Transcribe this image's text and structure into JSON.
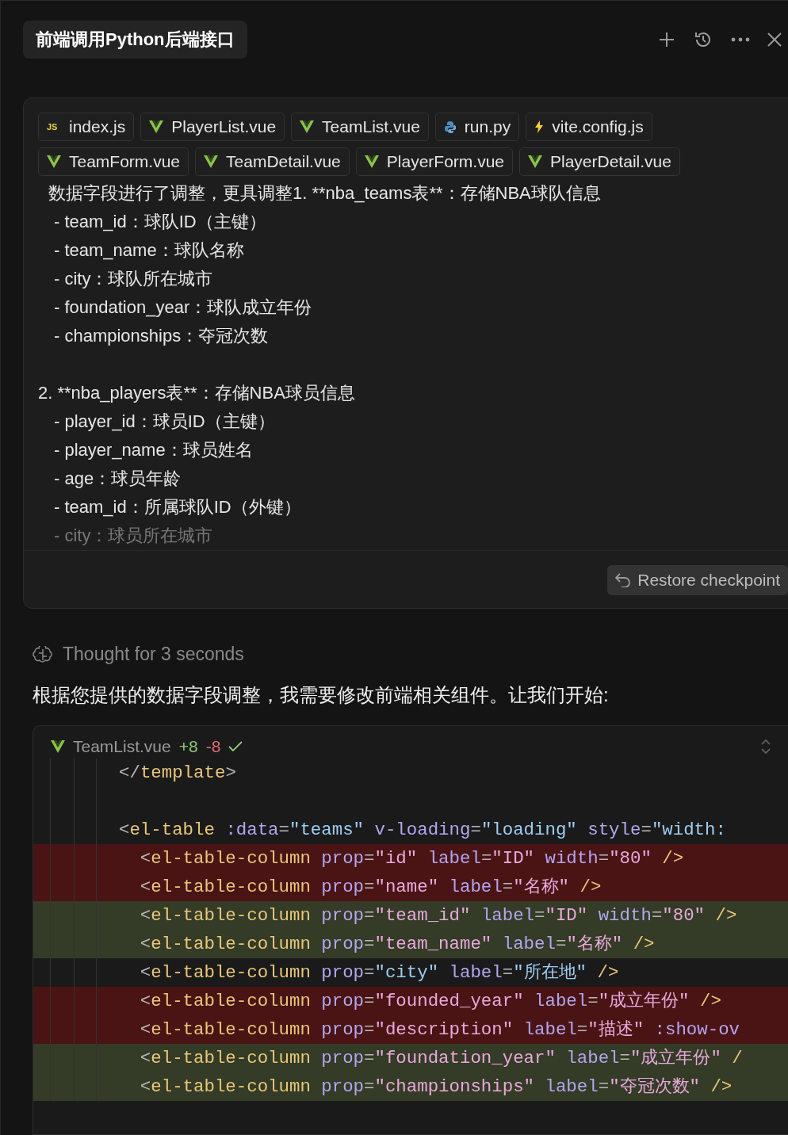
{
  "header": {
    "title": "前端调用Python后端接口"
  },
  "message": {
    "files": [
      {
        "name": "index.js",
        "kind": "js",
        "badge": "JS"
      },
      {
        "name": "PlayerList.vue",
        "kind": "vue"
      },
      {
        "name": "TeamList.vue",
        "kind": "vue"
      },
      {
        "name": "run.py",
        "kind": "py"
      },
      {
        "name": "vite.config.js",
        "kind": "vite"
      },
      {
        "name": "TeamForm.vue",
        "kind": "vue"
      },
      {
        "name": "TeamDetail.vue",
        "kind": "vue"
      },
      {
        "name": "PlayerForm.vue",
        "kind": "vue"
      },
      {
        "name": "PlayerDetail.vue",
        "kind": "vue"
      }
    ],
    "lines": [
      {
        "kind": "lead",
        "text": "数据字段进行了调整，更具调整1. **nba_teams表**：存储NBA球队信息",
        "faded": false
      },
      {
        "kind": "bullet",
        "text": "- team_id：球队ID（主键）",
        "faded": false
      },
      {
        "kind": "bullet",
        "text": "- team_name：球队名称",
        "faded": false
      },
      {
        "kind": "bullet",
        "text": "- city：球队所在城市",
        "faded": false
      },
      {
        "kind": "bullet",
        "text": "- foundation_year：球队成立年份",
        "faded": false
      },
      {
        "kind": "bullet",
        "text": "- championships：夺冠次数",
        "faded": false
      },
      {
        "kind": "numbered",
        "text": "2. **nba_players表**：存储NBA球员信息",
        "faded": false
      },
      {
        "kind": "bullet",
        "text": "- player_id：球员ID（主键）",
        "faded": false
      },
      {
        "kind": "bullet",
        "text": "- player_name：球员姓名",
        "faded": false
      },
      {
        "kind": "bullet",
        "text": "- age：球员年龄",
        "faded": false
      },
      {
        "kind": "bullet",
        "text": "- team_id：所属球队ID（外键）",
        "faded": false
      },
      {
        "kind": "bullet",
        "text": "- city：球员所在城市",
        "faded": true
      }
    ],
    "restore_button": "Restore checkpoint"
  },
  "thought": "Thought for 3 seconds",
  "reply": "根据您提供的数据字段调整，我需要修改前端相关组件。让我们开始:",
  "code_block": {
    "file": "TeamList.vue",
    "added": "+8",
    "removed": "-8",
    "applied": true,
    "lines": [
      {
        "kind": "plain",
        "tokens": [
          {
            "kind": "punct",
            "text": "</"
          },
          {
            "kind": "tag",
            "text": "template"
          },
          {
            "kind": "punct",
            "text": ">"
          }
        ]
      },
      {
        "kind": "plain"
      },
      {
        "kind": "plain",
        "tokens": [
          {
            "kind": "punct",
            "text": "<"
          },
          {
            "kind": "tag",
            "text": "el-table "
          },
          {
            "kind": "attr",
            "text": ":data"
          },
          {
            "kind": "punct",
            "text": "="
          },
          {
            "kind": "str",
            "text": "\"teams\" "
          },
          {
            "kind": "attr",
            "text": "v-loading"
          },
          {
            "kind": "punct",
            "text": "="
          },
          {
            "kind": "str",
            "text": "\"loading\" "
          },
          {
            "kind": "attr",
            "text": "style"
          },
          {
            "kind": "punct",
            "text": "="
          },
          {
            "kind": "str",
            "text": "\"width:"
          }
        ]
      },
      {
        "kind": "removed",
        "tokens": [
          {
            "kind": "punct",
            "text": "  <"
          },
          {
            "kind": "tag",
            "text": "el-table-column "
          },
          {
            "kind": "attr",
            "text": "prop"
          },
          {
            "kind": "punct",
            "text": "="
          },
          {
            "kind": "str",
            "text": "\"id\" "
          },
          {
            "kind": "attr",
            "text": "label"
          },
          {
            "kind": "punct",
            "text": "="
          },
          {
            "kind": "str",
            "text": "\"ID\" "
          },
          {
            "kind": "attr",
            "text": "width"
          },
          {
            "kind": "punct",
            "text": "="
          },
          {
            "kind": "str",
            "text": "\"80\" "
          },
          {
            "kind": "tag",
            "text": "/>"
          }
        ]
      },
      {
        "kind": "removed",
        "tokens": [
          {
            "kind": "punct",
            "text": "  <"
          },
          {
            "kind": "tag",
            "text": "el-table-column "
          },
          {
            "kind": "attr",
            "text": "prop"
          },
          {
            "kind": "punct",
            "text": "="
          },
          {
            "kind": "str",
            "text": "\"name\" "
          },
          {
            "kind": "attr",
            "text": "label"
          },
          {
            "kind": "punct",
            "text": "="
          },
          {
            "kind": "str",
            "text": "\"名称\" "
          },
          {
            "kind": "tag",
            "text": "/>"
          }
        ]
      },
      {
        "kind": "added",
        "tokens": [
          {
            "kind": "punct",
            "text": "  <"
          },
          {
            "kind": "tag",
            "text": "el-table-column "
          },
          {
            "kind": "attr",
            "text": "prop"
          },
          {
            "kind": "punct",
            "text": "="
          },
          {
            "kind": "str",
            "text": "\"team_id\" "
          },
          {
            "kind": "attr",
            "text": "label"
          },
          {
            "kind": "punct",
            "text": "="
          },
          {
            "kind": "str",
            "text": "\"ID\" "
          },
          {
            "kind": "attr",
            "text": "width"
          },
          {
            "kind": "punct",
            "text": "="
          },
          {
            "kind": "str",
            "text": "\"80\" "
          },
          {
            "kind": "tag",
            "text": "/>"
          }
        ]
      },
      {
        "kind": "added",
        "tokens": [
          {
            "kind": "punct",
            "text": "  <"
          },
          {
            "kind": "tag",
            "text": "el-table-column "
          },
          {
            "kind": "attr",
            "text": "prop"
          },
          {
            "kind": "punct",
            "text": "="
          },
          {
            "kind": "str",
            "text": "\"team_name\" "
          },
          {
            "kind": "attr",
            "text": "label"
          },
          {
            "kind": "punct",
            "text": "="
          },
          {
            "kind": "str",
            "text": "\"名称\" "
          },
          {
            "kind": "tag",
            "text": "/>"
          }
        ]
      },
      {
        "kind": "plain",
        "tokens": [
          {
            "kind": "punct",
            "text": "  <"
          },
          {
            "kind": "tag",
            "text": "el-table-column "
          },
          {
            "kind": "attr",
            "text": "prop"
          },
          {
            "kind": "punct",
            "text": "="
          },
          {
            "kind": "str",
            "text": "\"city\" "
          },
          {
            "kind": "attr",
            "text": "label"
          },
          {
            "kind": "punct",
            "text": "="
          },
          {
            "kind": "str",
            "text": "\"所在地\" "
          },
          {
            "kind": "tag",
            "text": "/>"
          }
        ]
      },
      {
        "kind": "removed",
        "tokens": [
          {
            "kind": "punct",
            "text": "  <"
          },
          {
            "kind": "tag",
            "text": "el-table-column "
          },
          {
            "kind": "attr",
            "text": "prop"
          },
          {
            "kind": "punct",
            "text": "="
          },
          {
            "kind": "str",
            "text": "\"founded_year\" "
          },
          {
            "kind": "attr",
            "text": "label"
          },
          {
            "kind": "punct",
            "text": "="
          },
          {
            "kind": "str",
            "text": "\"成立年份\" "
          },
          {
            "kind": "tag",
            "text": "/>"
          }
        ]
      },
      {
        "kind": "removed",
        "tokens": [
          {
            "kind": "punct",
            "text": "  <"
          },
          {
            "kind": "tag",
            "text": "el-table-column "
          },
          {
            "kind": "attr",
            "text": "prop"
          },
          {
            "kind": "punct",
            "text": "="
          },
          {
            "kind": "str",
            "text": "\"description\" "
          },
          {
            "kind": "attr",
            "text": "label"
          },
          {
            "kind": "punct",
            "text": "="
          },
          {
            "kind": "str",
            "text": "\"描述\" "
          },
          {
            "kind": "attr",
            "text": ":show-ov"
          }
        ]
      },
      {
        "kind": "added",
        "tokens": [
          {
            "kind": "punct",
            "text": "  <"
          },
          {
            "kind": "tag",
            "text": "el-table-column "
          },
          {
            "kind": "attr",
            "text": "prop"
          },
          {
            "kind": "punct",
            "text": "="
          },
          {
            "kind": "str",
            "text": "\"foundation_year\" "
          },
          {
            "kind": "attr",
            "text": "label"
          },
          {
            "kind": "punct",
            "text": "="
          },
          {
            "kind": "str",
            "text": "\"成立年份\" "
          },
          {
            "kind": "tag",
            "text": "/"
          }
        ]
      },
      {
        "kind": "added",
        "tokens": [
          {
            "kind": "punct",
            "text": "  <"
          },
          {
            "kind": "tag",
            "text": "el-table-column "
          },
          {
            "kind": "attr",
            "text": "prop"
          },
          {
            "kind": "punct",
            "text": "="
          },
          {
            "kind": "str",
            "text": "\"championships\" "
          },
          {
            "kind": "attr",
            "text": "label"
          },
          {
            "kind": "punct",
            "text": "="
          },
          {
            "kind": "str",
            "text": "\"夺冠次数\" "
          },
          {
            "kind": "tag",
            "text": "/>"
          }
        ]
      }
    ]
  }
}
